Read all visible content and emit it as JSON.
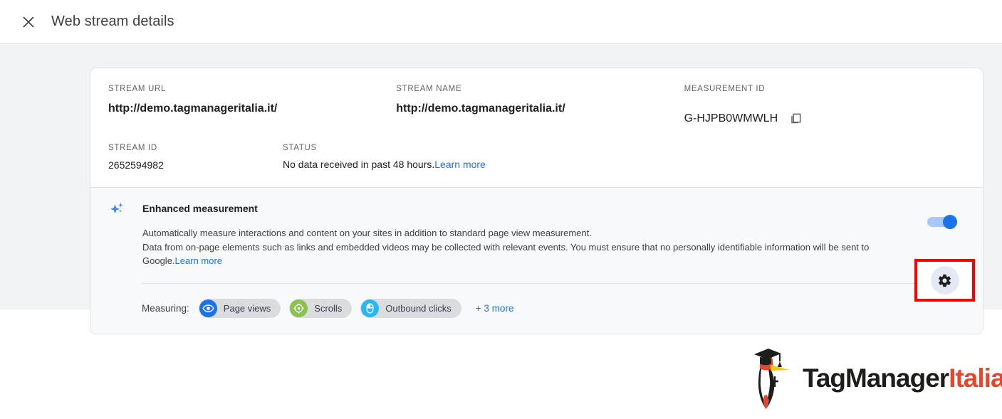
{
  "header": {
    "close_icon": "close-icon",
    "title": "Web stream details"
  },
  "stream": {
    "url_label": "STREAM URL",
    "url_value": "http://demo.tagmanageritalia.it/",
    "name_label": "STREAM NAME",
    "name_value": "http://demo.tagmanageritalia.it/",
    "measurement_id_label": "MEASUREMENT ID",
    "measurement_id_value": "G-HJPB0WMWLH",
    "copy_icon": "copy-icon",
    "stream_id_label": "STREAM ID",
    "stream_id_value": "2652594982",
    "status_label": "STATUS",
    "status_value": "No data received in past 48 hours.",
    "status_link": "Learn more"
  },
  "enhanced_measurement": {
    "sparkle_icon": "sparkle-icon",
    "title": "Enhanced measurement",
    "description_line1": "Automatically measure interactions and content on your sites in addition to standard page view measurement.",
    "description_line2": "Data from on-page elements such as links and embedded videos may be collected with relevant events. You must ensure that no personally identifiable information will be sent to Google.",
    "description_link": "Learn more",
    "toggle_state": "on",
    "toggle_color": "#1a73e8",
    "measuring_label": "Measuring:",
    "chips": [
      {
        "label": "Page views",
        "icon": "eye-icon",
        "color": "#1a73e8"
      },
      {
        "label": "Scrolls",
        "icon": "scroll-icon",
        "color": "#8ac14f"
      },
      {
        "label": "Outbound clicks",
        "icon": "mouse-icon",
        "color": "#29b6f6"
      }
    ],
    "more_link": "+ 3 more",
    "settings_icon": "gear-icon",
    "highlight_color": "#ff0000"
  },
  "logo": {
    "bird_icon": "woodpecker-logo-icon",
    "text_primary": "TagManager",
    "text_accent": "Italia",
    "primary_color": "#1d1d1b",
    "accent_color": "#e8452c"
  }
}
